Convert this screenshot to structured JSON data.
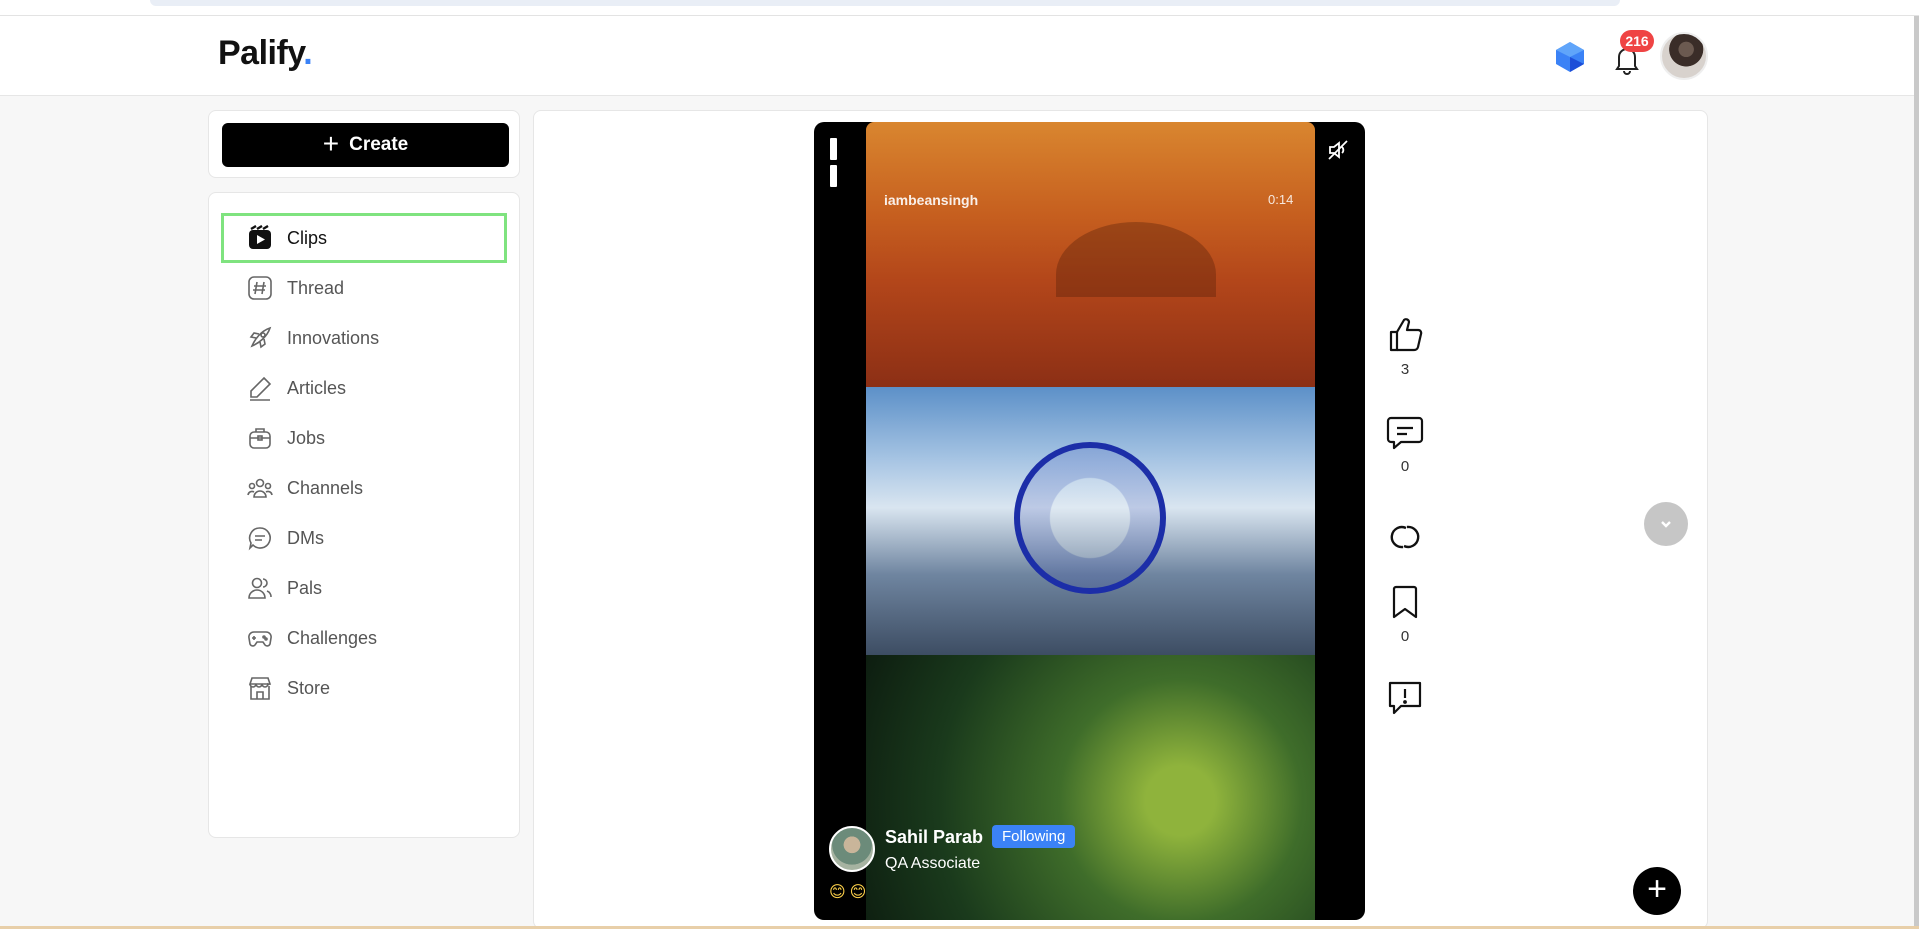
{
  "app": {
    "logo": "Palify",
    "logo_dot": "."
  },
  "header": {
    "notifications_count": "216",
    "gem_icon": "gem-icon",
    "bell_icon": "bell-icon",
    "avatar_icon": "user-avatar"
  },
  "sidebar": {
    "create_label": "Create",
    "items": [
      {
        "label": "Clips",
        "icon": "clips-icon",
        "active": true
      },
      {
        "label": "Thread",
        "icon": "hashtag-icon"
      },
      {
        "label": "Innovations",
        "icon": "rocket-icon"
      },
      {
        "label": "Articles",
        "icon": "pen-icon"
      },
      {
        "label": "Jobs",
        "icon": "briefcase-icon"
      },
      {
        "label": "Channels",
        "icon": "group-icon"
      },
      {
        "label": "DMs",
        "icon": "chat-icon"
      },
      {
        "label": "Pals",
        "icon": "people-icon"
      },
      {
        "label": "Challenges",
        "icon": "gamepad-icon"
      },
      {
        "label": "Store",
        "icon": "store-icon"
      }
    ]
  },
  "clip": {
    "uploader": "iambeansingh",
    "duration": "0:14",
    "author_name": "Sahil Parab",
    "follow_status": "Following",
    "author_role": "QA Associate",
    "emojis": "😊😊"
  },
  "actions": {
    "likes": "3",
    "comments": "0",
    "saves": "0"
  },
  "colors": {
    "accent": "#3b82f6",
    "badge": "#ef4444",
    "active_outline": "#7fe37f"
  }
}
